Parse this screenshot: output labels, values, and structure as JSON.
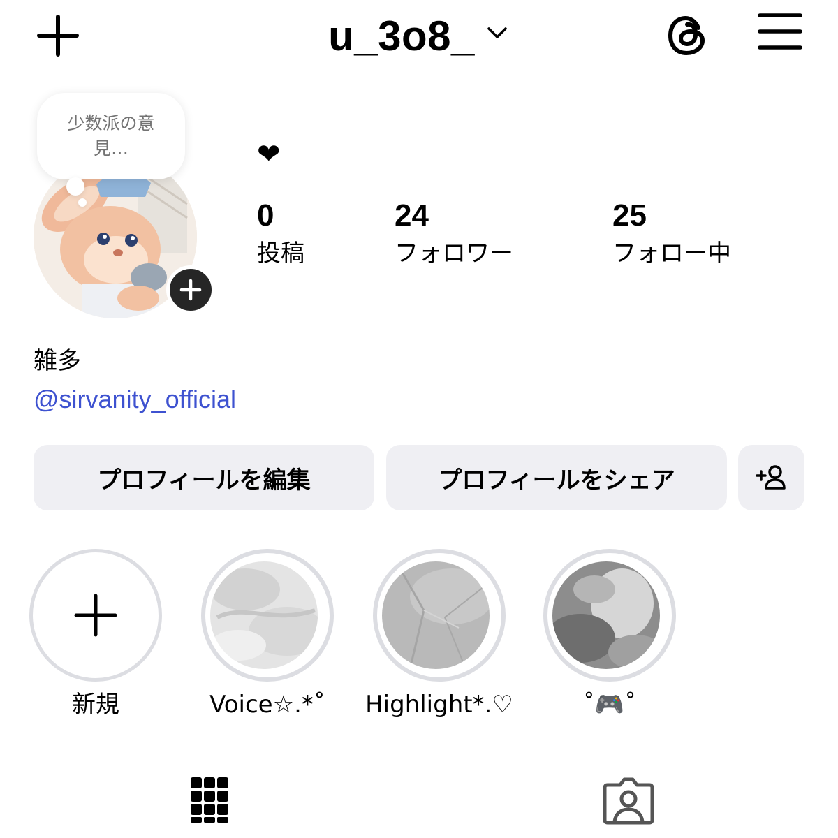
{
  "header": {
    "username": "u_3o8_"
  },
  "note": {
    "text": "少数派の意見…"
  },
  "profile": {
    "full_name": "❤",
    "stats": {
      "posts": {
        "count": "0",
        "label": "投稿"
      },
      "followers": {
        "count": "24",
        "label": "フォロワー"
      },
      "following": {
        "count": "25",
        "label": "フォロー中"
      }
    },
    "bio_category": "雑多",
    "bio_link": "@sirvanity_official"
  },
  "actions": {
    "edit_label": "プロフィールを編集",
    "share_label": "プロフィールをシェア"
  },
  "highlights": [
    {
      "label": "新規"
    },
    {
      "label": "Voice☆.*˚"
    },
    {
      "label": "Highlight*.♡"
    },
    {
      "label": "˚🎮˚"
    }
  ],
  "icons": {
    "create": "plus-icon",
    "account_switch": "chevron-down-icon",
    "threads": "threads-icon",
    "menu": "hamburger-menu-icon",
    "avatar_add": "plus-icon",
    "discover": "add-person-icon",
    "grid_tab": "grid-icon",
    "tagged_tab": "tagged-person-icon"
  },
  "colors": {
    "link": "#3e52d0",
    "button_bg": "#efeff3",
    "ring": "#dcdde2",
    "avatar_badge": "#262626"
  }
}
